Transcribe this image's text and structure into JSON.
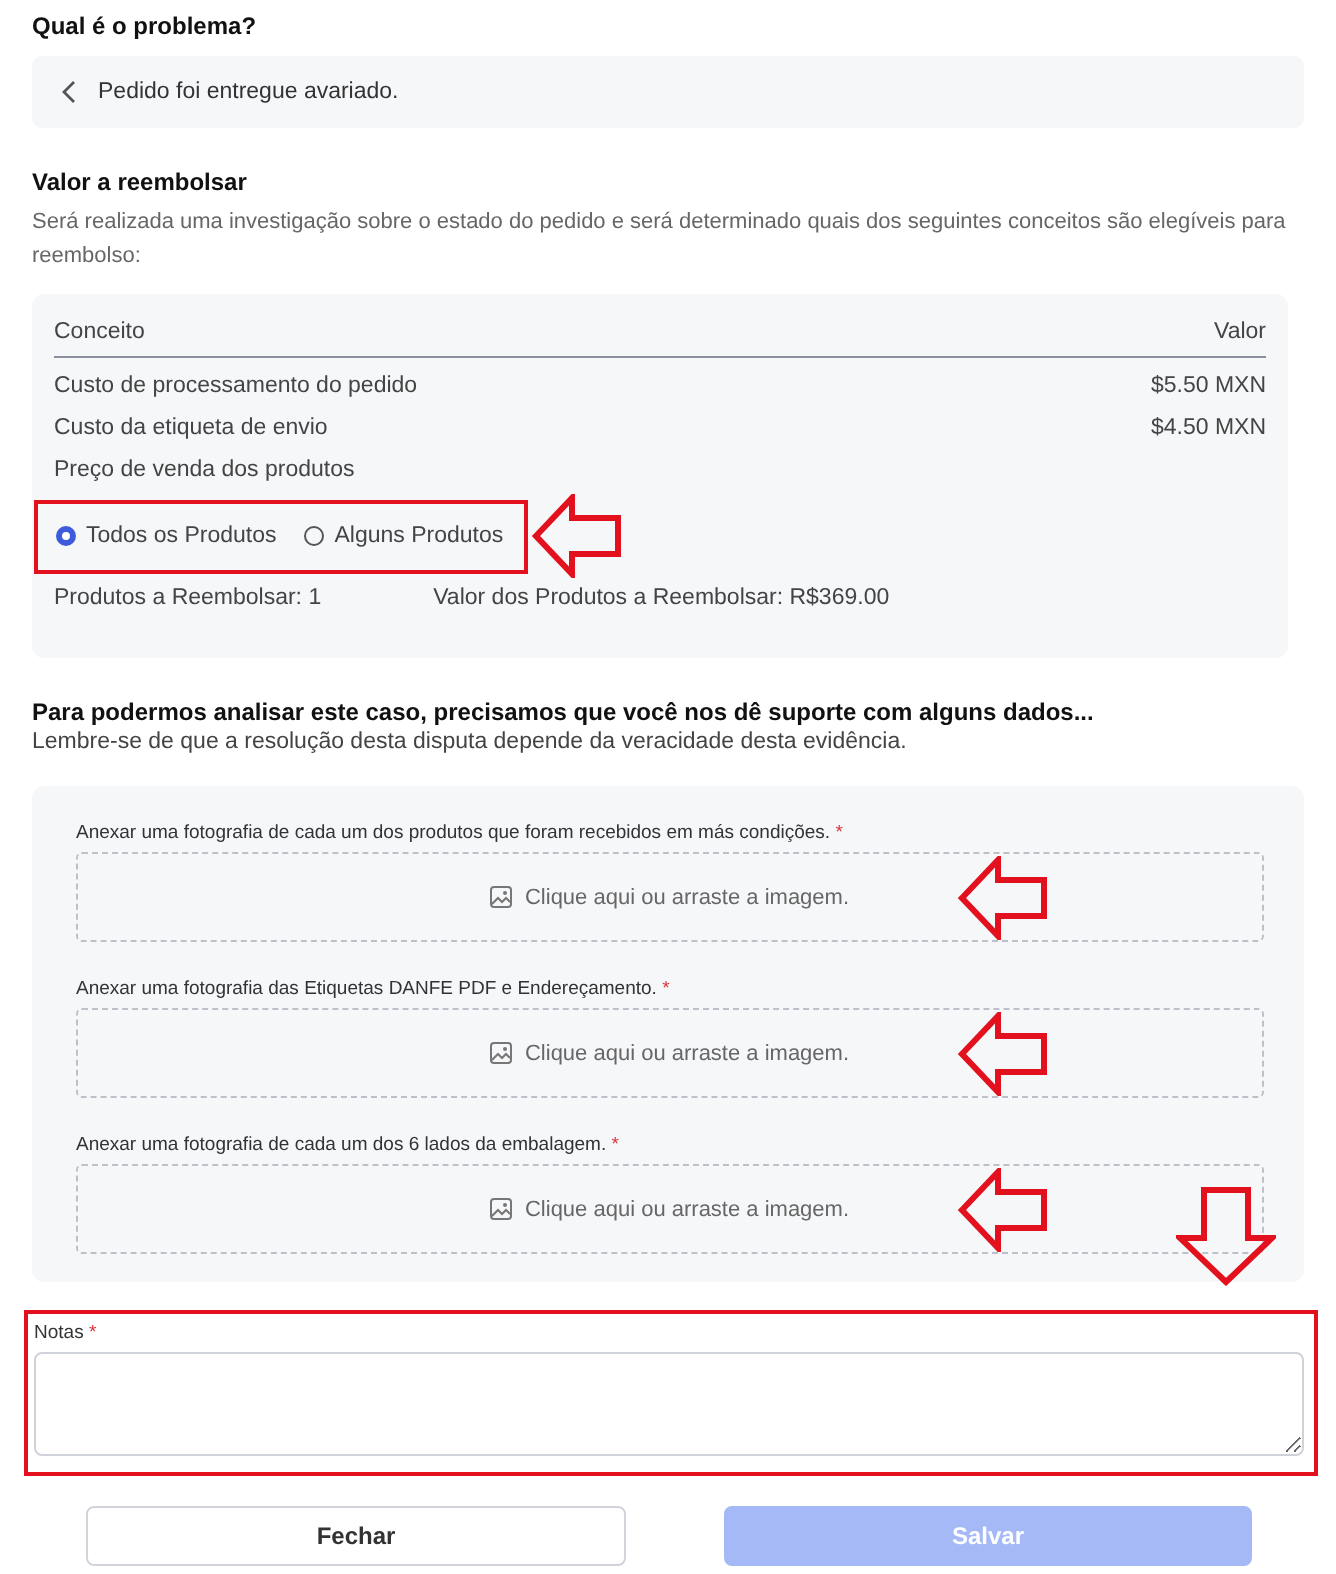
{
  "problem": {
    "heading": "Qual é o problema?",
    "value": "Pedido foi entregue avariado."
  },
  "refund": {
    "heading": "Valor a reembolsar",
    "description": "Será realizada uma investigação sobre o estado do pedido e será determinado quais dos seguintes conceitos são elegíveis para reembolso:",
    "table": {
      "columns": [
        "Conceito",
        "Valor"
      ],
      "rows": [
        {
          "concept": "Custo de processamento do pedido",
          "value": "$5.50 MXN"
        },
        {
          "concept": "Custo da etiqueta de envio",
          "value": "$4.50 MXN"
        },
        {
          "concept": "Preço de venda dos produtos"
        }
      ]
    },
    "options": [
      {
        "label": "Todos os Produtos",
        "selected": true
      },
      {
        "label": "Alguns Produtos",
        "selected": false
      }
    ],
    "summary": [
      "Produtos a Reembolsar: 1",
      "Valor dos Produtos a Reembolsar: R$369.00"
    ]
  },
  "evidence": {
    "heading": "Para podermos analisar este caso, precisamos que você nos dê suporte com alguns dados...",
    "subtext": "Lembre-se de que a resolução desta disputa depende da veracidade desta evidência.",
    "uploads": [
      {
        "label": "Anexar uma fotografia de cada um dos produtos que foram recebidos em más condições.",
        "required": "*",
        "placeholder": "Clique aqui ou arraste a imagem."
      },
      {
        "label": "Anexar uma fotografia das Etiquetas DANFE PDF e Endereçamento.",
        "required": "*",
        "placeholder": "Clique aqui ou arraste a imagem."
      },
      {
        "label": "Anexar uma fotografia de cada um dos 6 lados da embalagem.",
        "required": "*",
        "placeholder": "Clique aqui ou arraste a imagem."
      }
    ]
  },
  "notes": {
    "label": "Notas",
    "required": "*"
  },
  "buttons": [
    {
      "label": "Fechar",
      "kind": "secondary",
      "disabled": false
    },
    {
      "label": "Salvar",
      "kind": "primary",
      "disabled": true
    }
  ]
}
